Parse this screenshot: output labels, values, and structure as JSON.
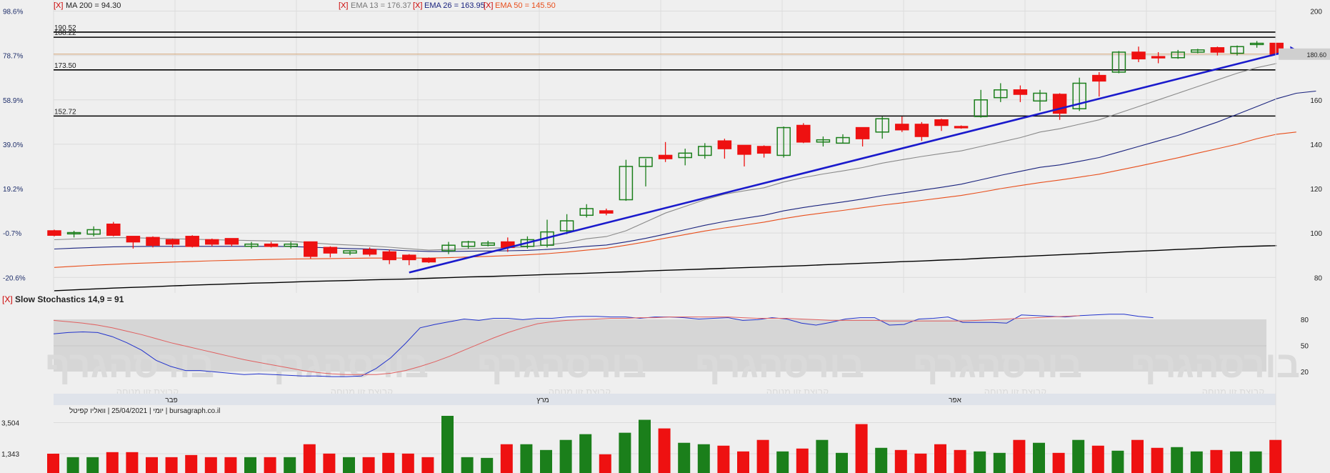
{
  "header": {
    "ma200_close": "[X]",
    "ma200_label": "MA 200 = 94.30",
    "ema13_close": "[X]",
    "ema13_label": "EMA 13 = 176.37",
    "ema26_close": "[X]",
    "ema26_label": "EMA 26 = 163.95",
    "ema50_close": "[X]",
    "ema50_label": "EMA 50 = 145.50"
  },
  "price_panel": {
    "ylim": [
      73,
      205
    ],
    "right_ticks": [
      {
        "v": 200,
        "t": "200"
      },
      {
        "v": 180,
        "t": "180"
      },
      {
        "v": 160,
        "t": "160"
      },
      {
        "v": 140,
        "t": "140"
      },
      {
        "v": 120,
        "t": "120"
      },
      {
        "v": 100,
        "t": "100"
      },
      {
        "v": 80,
        "t": "80"
      }
    ],
    "left_ticks": [
      {
        "v": 200,
        "t": "98.6%"
      },
      {
        "v": 180,
        "t": "78.7%"
      },
      {
        "v": 160,
        "t": "58.9%"
      },
      {
        "v": 140,
        "t": "39.0%"
      },
      {
        "v": 120,
        "t": "19.2%"
      },
      {
        "v": 100,
        "t": "-0.7%"
      },
      {
        "v": 80,
        "t": "-20.6%"
      }
    ],
    "hlines": [
      {
        "v": 190.52,
        "label": "190.52"
      },
      {
        "v": 188.22,
        "label": "188.22"
      },
      {
        "v": 173.5,
        "label": "173.50"
      },
      {
        "v": 152.72,
        "label": "152.72"
      }
    ],
    "last_price": {
      "v": 180.6,
      "label": "180.60"
    },
    "trendline": {
      "from": [
        18,
        82.2
      ],
      "to": [
        62,
        181.3
      ]
    }
  },
  "chart_data": [
    {
      "type": "candlestick",
      "title": "",
      "x_month_labels": [
        {
          "i": 6,
          "label": "פבר"
        },
        {
          "i": 26,
          "label": "מרץ"
        },
        {
          "i": 47,
          "label": "אפר"
        }
      ],
      "candles": [
        {
          "o": 101.0,
          "h": 101.5,
          "l": 98.5,
          "c": 99.0
        },
        {
          "o": 100.0,
          "h": 101.0,
          "l": 98.0,
          "c": 100.2
        },
        {
          "o": 99.5,
          "h": 103.0,
          "l": 98.5,
          "c": 101.5
        },
        {
          "o": 104.0,
          "h": 105.0,
          "l": 98.5,
          "c": 99.0
        },
        {
          "o": 98.5,
          "h": 98.5,
          "l": 93.0,
          "c": 96.0
        },
        {
          "o": 98.0,
          "h": 98.5,
          "l": 93.5,
          "c": 94.5
        },
        {
          "o": 97.0,
          "h": 97.5,
          "l": 93.5,
          "c": 95.0
        },
        {
          "o": 98.5,
          "h": 99.0,
          "l": 93.5,
          "c": 94.0
        },
        {
          "o": 97.0,
          "h": 97.5,
          "l": 94.0,
          "c": 95.0
        },
        {
          "o": 97.5,
          "h": 97.5,
          "l": 94.0,
          "c": 95.0
        },
        {
          "o": 94.0,
          "h": 96.0,
          "l": 93.0,
          "c": 95.0
        },
        {
          "o": 95.0,
          "h": 96.0,
          "l": 93.5,
          "c": 94.0
        },
        {
          "o": 94.0,
          "h": 96.0,
          "l": 93.0,
          "c": 95.0
        },
        {
          "o": 96.0,
          "h": 96.0,
          "l": 88.5,
          "c": 89.5
        },
        {
          "o": 93.5,
          "h": 94.0,
          "l": 89.0,
          "c": 91.0
        },
        {
          "o": 91.0,
          "h": 92.0,
          "l": 90.0,
          "c": 92.0
        },
        {
          "o": 92.5,
          "h": 93.5,
          "l": 89.5,
          "c": 90.5
        },
        {
          "o": 91.5,
          "h": 92.5,
          "l": 86.0,
          "c": 88.0
        },
        {
          "o": 90.0,
          "h": 90.5,
          "l": 85.5,
          "c": 88.0
        },
        {
          "o": 88.5,
          "h": 89.0,
          "l": 86.5,
          "c": 87.0
        },
        {
          "o": 92.0,
          "h": 96.0,
          "l": 90.5,
          "c": 94.5
        },
        {
          "o": 94.0,
          "h": 96.5,
          "l": 93.0,
          "c": 96.0
        },
        {
          "o": 94.5,
          "h": 96.5,
          "l": 94.0,
          "c": 95.5
        },
        {
          "o": 96.0,
          "h": 98.0,
          "l": 91.5,
          "c": 93.5
        },
        {
          "o": 94.0,
          "h": 98.5,
          "l": 93.0,
          "c": 97.0
        },
        {
          "o": 94.5,
          "h": 106.0,
          "l": 93.5,
          "c": 100.5
        },
        {
          "o": 101.0,
          "h": 108.5,
          "l": 99.5,
          "c": 105.5
        },
        {
          "o": 108.0,
          "h": 113.0,
          "l": 107.0,
          "c": 111.0
        },
        {
          "o": 110.0,
          "h": 111.0,
          "l": 108.0,
          "c": 109.0
        },
        {
          "o": 115.0,
          "h": 133.0,
          "l": 114.5,
          "c": 130.0
        },
        {
          "o": 130.0,
          "h": 133.5,
          "l": 121.0,
          "c": 134.0
        },
        {
          "o": 135.0,
          "h": 141.0,
          "l": 132.0,
          "c": 133.5
        },
        {
          "o": 134.0,
          "h": 138.0,
          "l": 130.5,
          "c": 136.0
        },
        {
          "o": 135.0,
          "h": 140.5,
          "l": 133.5,
          "c": 139.0
        },
        {
          "o": 141.5,
          "h": 142.5,
          "l": 133.5,
          "c": 138.0
        },
        {
          "o": 139.5,
          "h": 139.5,
          "l": 130.0,
          "c": 135.5
        },
        {
          "o": 139.0,
          "h": 139.5,
          "l": 134.0,
          "c": 136.0
        },
        {
          "o": 135.0,
          "h": 148.0,
          "l": 134.0,
          "c": 147.5
        },
        {
          "o": 148.5,
          "h": 149.5,
          "l": 140.5,
          "c": 141.0
        },
        {
          "o": 141.0,
          "h": 143.5,
          "l": 139.0,
          "c": 142.0
        },
        {
          "o": 140.5,
          "h": 144.5,
          "l": 140.5,
          "c": 143.0
        },
        {
          "o": 147.5,
          "h": 147.5,
          "l": 139.0,
          "c": 142.5
        },
        {
          "o": 145.5,
          "h": 152.5,
          "l": 142.5,
          "c": 151.5
        },
        {
          "o": 149.0,
          "h": 152.5,
          "l": 145.5,
          "c": 146.5
        },
        {
          "o": 149.0,
          "h": 150.0,
          "l": 141.5,
          "c": 143.5
        },
        {
          "o": 151.0,
          "h": 151.5,
          "l": 146.0,
          "c": 148.5
        },
        {
          "o": 148.0,
          "h": 148.5,
          "l": 147.0,
          "c": 147.5
        },
        {
          "o": 152.5,
          "h": 164.5,
          "l": 152.0,
          "c": 160.0
        },
        {
          "o": 161.0,
          "h": 167.5,
          "l": 159.0,
          "c": 164.5
        },
        {
          "o": 164.5,
          "h": 166.5,
          "l": 159.0,
          "c": 162.5
        },
        {
          "o": 159.5,
          "h": 164.5,
          "l": 155.0,
          "c": 163.0
        },
        {
          "o": 162.5,
          "h": 163.0,
          "l": 151.0,
          "c": 154.0
        },
        {
          "o": 156.0,
          "h": 170.0,
          "l": 155.0,
          "c": 167.5
        },
        {
          "o": 171.0,
          "h": 172.5,
          "l": 161.5,
          "c": 168.5
        },
        {
          "o": 172.5,
          "h": 182.0,
          "l": 172.0,
          "c": 181.5
        },
        {
          "o": 181.5,
          "h": 184.0,
          "l": 177.0,
          "c": 178.5
        },
        {
          "o": 179.5,
          "h": 181.5,
          "l": 176.5,
          "c": 179.0
        },
        {
          "o": 179.0,
          "h": 182.5,
          "l": 178.5,
          "c": 181.5
        },
        {
          "o": 181.5,
          "h": 183.0,
          "l": 181.0,
          "c": 182.5
        },
        {
          "o": 183.5,
          "h": 184.0,
          "l": 180.0,
          "c": 181.5
        },
        {
          "o": 181.0,
          "h": 184.5,
          "l": 180.0,
          "c": 184.0
        },
        {
          "o": 185.0,
          "h": 186.5,
          "l": 183.5,
          "c": 185.5
        },
        {
          "o": 185.5,
          "h": 185.5,
          "l": 180.6,
          "c": 180.6
        }
      ],
      "series": [
        {
          "name": "MA 200",
          "color": "#000000",
          "values": [
            74.0,
            74.4,
            74.8,
            75.2,
            75.5,
            75.8,
            76.2,
            76.5,
            76.8,
            77.1,
            77.4,
            77.6,
            77.9,
            78.2,
            78.4,
            78.6,
            78.9,
            79.1,
            79.3,
            79.6,
            79.9,
            80.2,
            80.4,
            80.7,
            81.0,
            81.3,
            81.6,
            81.9,
            82.2,
            82.5,
            82.9,
            83.2,
            83.5,
            83.8,
            84.1,
            84.4,
            84.7,
            85.0,
            85.3,
            85.7,
            86.0,
            86.4,
            86.7,
            87.1,
            87.4,
            87.8,
            88.1,
            88.6,
            89.0,
            89.4,
            89.8,
            90.2,
            90.6,
            91.0,
            91.4,
            91.8,
            92.2,
            92.6,
            93.0,
            93.4,
            93.8,
            94.1,
            94.3
          ]
        },
        {
          "name": "EMA 13",
          "color": "#8a8a8a",
          "values": [
            97.0,
            97.3,
            97.6,
            97.9,
            97.9,
            97.6,
            97.4,
            97.2,
            97.0,
            96.8,
            96.6,
            96.4,
            96.3,
            95.6,
            95.0,
            94.6,
            94.2,
            93.6,
            92.9,
            92.3,
            92.6,
            92.9,
            93.2,
            93.4,
            93.8,
            94.6,
            95.7,
            97.4,
            98.4,
            101.0,
            105.0,
            109.0,
            112.0,
            115.0,
            117.5,
            119.0,
            120.4,
            123.0,
            125.0,
            126.6,
            128.0,
            129.5,
            131.5,
            133.0,
            134.5,
            135.8,
            137.0,
            139.0,
            141.0,
            143.0,
            145.5,
            147.0,
            149.0,
            151.0,
            154.0,
            157.0,
            160.0,
            163.0,
            166.0,
            169.0,
            172.0,
            174.5,
            176.4
          ]
        },
        {
          "name": "EMA 26",
          "color": "#1a237e",
          "values": [
            92.8,
            93.2,
            93.5,
            93.8,
            93.9,
            94.0,
            94.0,
            94.0,
            94.0,
            94.0,
            94.0,
            94.0,
            93.9,
            93.6,
            93.3,
            93.0,
            92.8,
            92.4,
            92.0,
            91.7,
            91.7,
            91.8,
            91.9,
            92.0,
            92.2,
            92.6,
            93.2,
            94.0,
            94.6,
            96.0,
            97.6,
            99.5,
            101.5,
            103.5,
            105.2,
            106.6,
            108.0,
            110.0,
            111.5,
            112.8,
            114.0,
            115.3,
            116.8,
            118.0,
            119.3,
            120.6,
            122.0,
            124.0,
            126.0,
            127.8,
            129.6,
            130.7,
            132.3,
            134.0,
            136.5,
            139.0,
            141.5,
            144.0,
            147.0,
            150.0,
            153.5,
            157.0,
            160.5,
            163.0,
            163.95
          ]
        },
        {
          "name": "EMA 50",
          "color": "#e84e1b",
          "values": [
            84.5,
            85.0,
            85.5,
            85.9,
            86.3,
            86.6,
            86.9,
            87.2,
            87.5,
            87.7,
            87.9,
            88.1,
            88.3,
            88.4,
            88.5,
            88.6,
            88.7,
            88.7,
            88.7,
            88.7,
            88.9,
            89.2,
            89.5,
            89.8,
            90.2,
            90.7,
            91.4,
            92.3,
            93.1,
            94.5,
            96.0,
            97.7,
            99.3,
            100.9,
            102.3,
            103.6,
            104.9,
            106.5,
            107.9,
            109.1,
            110.2,
            111.4,
            112.6,
            113.6,
            114.7,
            115.8,
            116.9,
            118.4,
            120.0,
            121.4,
            122.7,
            123.9,
            125.2,
            126.5,
            128.3,
            130.1,
            132.0,
            133.9,
            136.0,
            138.0,
            140.0,
            142.5,
            144.5,
            145.5
          ]
        }
      ]
    },
    {
      "type": "line",
      "title": "Slow Stochastics 14,9 = 91",
      "ylim": [
        0,
        100
      ],
      "ticks": [
        {
          "v": 80,
          "t": "80"
        },
        {
          "v": 50,
          "t": "50"
        },
        {
          "v": 20,
          "t": "20"
        }
      ],
      "series": [
        {
          "name": "%K",
          "color": "#2233cc",
          "values": [
            76,
            78,
            79,
            78,
            72,
            63,
            52,
            37,
            28,
            22,
            22,
            20,
            18,
            16,
            17,
            16,
            15,
            14,
            14,
            13,
            13,
            14,
            25,
            41,
            62,
            85,
            90,
            94,
            98,
            96,
            99,
            99,
            97,
            99,
            99,
            101,
            102,
            102,
            101,
            101,
            99,
            101,
            101,
            100,
            98,
            99,
            100,
            96,
            97,
            100,
            98,
            92,
            89,
            93,
            98,
            100,
            100,
            89,
            90,
            98,
            99,
            101,
            93,
            93,
            93,
            92,
            104,
            103,
            102,
            101,
            103,
            104,
            105,
            105,
            102,
            100
          ]
        },
        {
          "name": "%D",
          "color": "#e06060",
          "values": [
            96,
            94,
            92,
            89,
            85,
            80,
            75,
            69,
            63,
            58,
            53,
            48,
            43,
            38,
            34,
            30,
            26,
            22,
            19,
            17,
            16,
            16,
            16,
            18,
            22,
            28,
            35,
            43,
            52,
            61,
            70,
            78,
            85,
            91,
            94,
            96,
            97,
            98,
            99,
            99,
            100,
            100,
            101,
            101,
            101,
            101,
            101,
            100,
            99,
            99,
            99,
            98,
            97,
            96,
            96,
            96,
            96,
            95,
            95,
            95,
            95,
            95,
            95,
            96,
            97,
            98,
            99,
            100,
            101,
            102,
            103
          ]
        }
      ],
      "bands": [
        {
          "from": 80,
          "to": 50
        },
        {
          "from": 50,
          "to": 20
        }
      ]
    },
    {
      "type": "bar",
      "title": "",
      "ylim": [
        0,
        5500
      ],
      "ticks": [
        {
          "v": 3504,
          "t": "3,504"
        },
        {
          "v": 1343,
          "t": "1,343"
        }
      ],
      "values": [
        1343,
        1100,
        1100,
        1450,
        1450,
        1100,
        1100,
        1250,
        1100,
        1100,
        1100,
        1100,
        1100,
        2000,
        1350,
        1100,
        1100,
        1400,
        1350,
        1100,
        4800,
        1100,
        1050,
        2000,
        2000,
        1600,
        2300,
        2700,
        1300,
        2800,
        3700,
        3100,
        2100,
        2000,
        1900,
        1500,
        2300,
        1500,
        1700,
        2300,
        1400,
        3400,
        1750,
        1600,
        1350,
        2000,
        1600,
        1500,
        1400,
        2300,
        2100,
        1400,
        2300,
        1900,
        1550,
        2300,
        1750,
        1800,
        1500,
        1600,
        1500,
        1500,
        2300
      ]
    }
  ],
  "stoch_panel": {
    "close_label": "[X]",
    "title": "Slow Stochastics 14,9 = 91"
  },
  "axis_panel": {
    "footer": "יומי | 25/04/2021 | וואליו קפיטל | bursagraph.co.il",
    "watermark": "בורסהגרף",
    "watermark_sub": "קבוצת זון מנוחה"
  },
  "volume_panel": {
    "tick_3504": "3,504",
    "tick_1343": "1,343"
  },
  "colors": {
    "bg": "#efefef",
    "grid": "#dcdcdc",
    "up": "#1b7f1b",
    "down": "#ee1111",
    "trend": "#1a1acc",
    "close_x": "#cc0000",
    "band": "#d6d6d6",
    "axisbar": "#dfe3ea"
  }
}
